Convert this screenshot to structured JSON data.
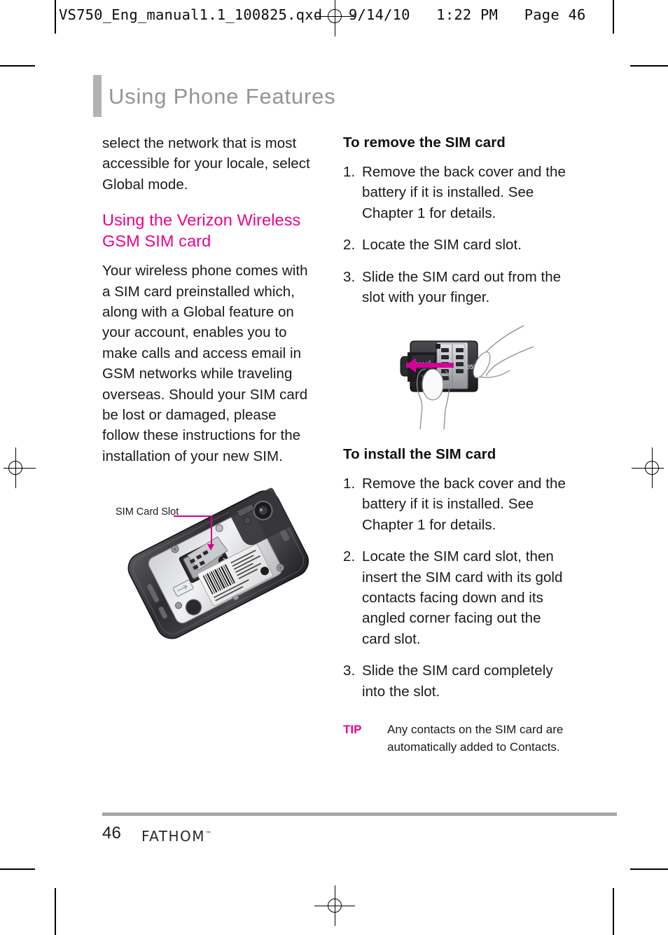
{
  "print_header": {
    "text": "VS750_Eng_manual1.1_100825.qxd   9/14/10   1:22 PM   Page 46"
  },
  "chapter": {
    "title": "Using Phone Features"
  },
  "left_column": {
    "continued_paragraph": "select the network that is most accessible for your locale, select Global mode.",
    "section_heading": "Using the Verizon Wireless GSM SIM card",
    "paragraph": "Your wireless phone comes with a SIM card preinstalled which, along with a Global feature on your account, enables you to make calls and access email in GSM networks while traveling overseas. Should your SIM card be lost or damaged, please follow these instructions for the installation of your new SIM.",
    "figure": {
      "name": "phone-back-cover-removed",
      "callout_label": "SIM Card Slot"
    }
  },
  "right_column": {
    "remove_section": {
      "heading": "To remove the SIM card",
      "steps": [
        {
          "num": "1.",
          "text": "Remove the back cover and the battery if it is installed. See Chapter 1 for details."
        },
        {
          "num": "2.",
          "text": "Locate the SIM card slot."
        },
        {
          "num": "3.",
          "text": "Slide the SIM card out from the slot with your finger."
        }
      ]
    },
    "figure": {
      "name": "sim-slide-out-with-finger"
    },
    "install_section": {
      "heading": "To install the SIM card",
      "steps": [
        {
          "num": "1.",
          "text": "Remove the back cover and the battery if it is installed. See Chapter 1 for details."
        },
        {
          "num": "2.",
          "text": "Locate the SIM card slot, then insert the SIM card with its gold contacts facing down and its angled corner facing out the card slot."
        },
        {
          "num": "3.",
          "text": "Slide the SIM card completely into the slot."
        }
      ]
    },
    "tip": {
      "label": "TIP",
      "text": "Any contacts on the SIM card are automatically added to Contacts."
    }
  },
  "footer": {
    "page_number": "46",
    "brand": "FATHOM",
    "trademark": "™"
  },
  "colors": {
    "accent_magenta": "#ec008c",
    "chapter_gray": "#949494",
    "bar_gray": "#b3b3b3",
    "rule_gray": "#a8a8a8"
  }
}
